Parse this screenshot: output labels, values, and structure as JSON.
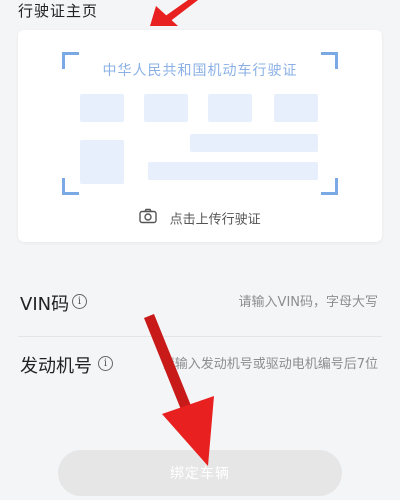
{
  "section_title": "行驶证主页",
  "upload_card": {
    "license_title": "中华人民共和国机动车行驶证",
    "upload_label": "点击上传行驶证",
    "icon": "camera-icon"
  },
  "form": {
    "vin": {
      "label": "VIN码",
      "info_icon": "i",
      "placeholder": "请输入VIN码，字母大写"
    },
    "engine": {
      "label": "发动机号",
      "info_icon": "i",
      "placeholder": "请输入发动机号或驱动电机编号后7位"
    }
  },
  "bind_button": {
    "label": "绑定车辆"
  },
  "colors": {
    "accent_blue": "#7aa9e6",
    "arrow_red": "#e8201f",
    "button_disabled": "#e6e6e6"
  }
}
